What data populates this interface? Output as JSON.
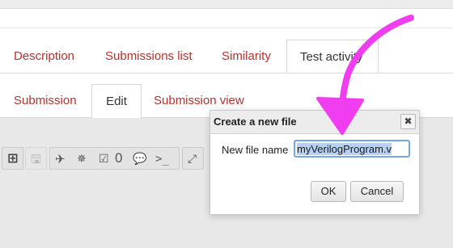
{
  "tabs_top": [
    {
      "label": "Description"
    },
    {
      "label": "Submissions list"
    },
    {
      "label": "Similarity"
    },
    {
      "label": "Test activity"
    }
  ],
  "tabs_sub": [
    {
      "label": "Submission"
    },
    {
      "label": "Edit"
    },
    {
      "label": "Submission view"
    }
  ],
  "toolbar": {
    "count": "0",
    "terminal_text": ">_"
  },
  "dialog": {
    "title": "Create a new file",
    "label": "New file name",
    "value": "myVerilogProgram.v",
    "ok": "OK",
    "cancel": "Cancel"
  },
  "colors": {
    "tab_link": "#b7312c",
    "annotation": "#f13df0"
  }
}
